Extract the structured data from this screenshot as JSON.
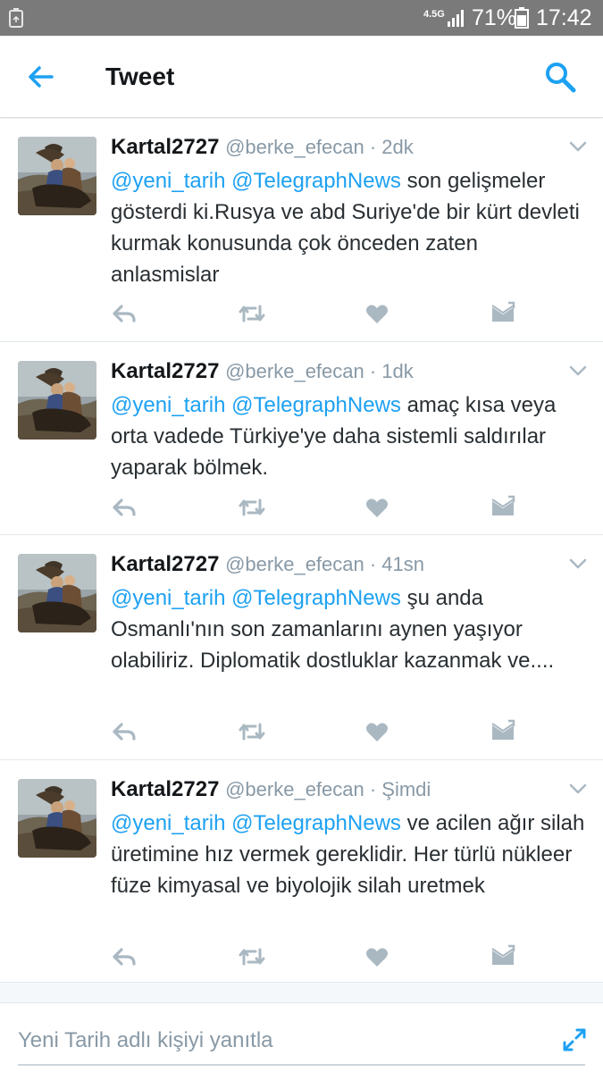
{
  "status_bar": {
    "network": "4.5G",
    "battery": "71%",
    "time": "17:42"
  },
  "app_bar": {
    "title": "Tweet",
    "back_icon": "arrow-left-icon",
    "search_icon": "search-icon"
  },
  "colors": {
    "accent": "#1da1f2",
    "text": "#292f33",
    "muted": "#8899a6",
    "action_icon": "#aab8c2"
  },
  "tweets": [
    {
      "name": "Kartal2727",
      "handle": "@berke_efecan · 2dk",
      "mention1": "@yeni_tarih",
      "mention2": "@TelegraphNews",
      "body": "son gelişmeler gösterdi ki.Rusya ve abd Suriye'de bir kürt devleti kurmak konusunda çok önceden zaten anlasmislar"
    },
    {
      "name": "Kartal2727",
      "handle": "@berke_efecan · 1dk",
      "mention1": "@yeni_tarih",
      "mention2": "@TelegraphNews",
      "body": "amaç kısa veya orta vadede Türkiye'ye daha sistemli saldırılar yaparak bölmek."
    },
    {
      "name": "Kartal2727",
      "handle": "@berke_efecan · 41sn",
      "mention1": "@yeni_tarih",
      "mention2": "@TelegraphNews",
      "body": "şu anda Osmanlı'nın son zamanlarını aynen yaşıyor olabiliriz. Diplomatik dostluklar kazanmak ve...."
    },
    {
      "name": "Kartal2727",
      "handle": "@berke_efecan · Şimdi",
      "mention1": "@yeni_tarih",
      "mention2": "@TelegraphNews",
      "body": "ve acilen ağır silah üretimine hız vermek gereklidir. Her türlü nükleer füze kimyasal ve biyolojik silah uretmek"
    }
  ],
  "reply_bar": {
    "placeholder": "Yeni Tarih adlı kişiyi yanıtla",
    "expand_icon": "expand-icon"
  }
}
